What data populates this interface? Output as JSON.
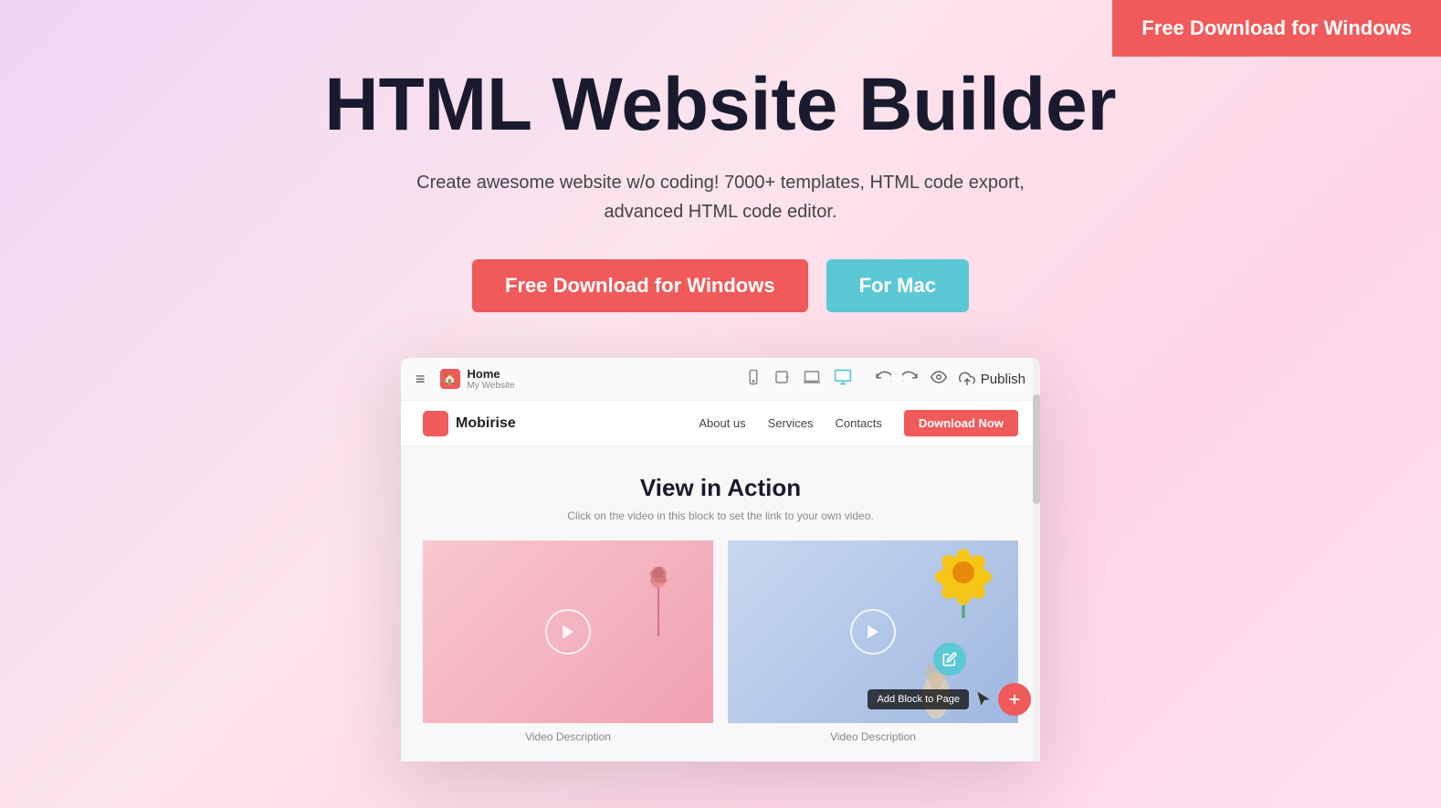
{
  "page": {
    "background": "linear-gradient(135deg, #f0d6f5, #fce4ec, #ffd6e8)"
  },
  "top_cta": {
    "label": "Free Download for Windows"
  },
  "hero": {
    "title": "HTML Website Builder",
    "subtitle": "Create awesome website w/o coding! 7000+ templates, HTML code export, advanced HTML code editor.",
    "btn_windows": "Free Download for Windows",
    "btn_mac": "For Mac"
  },
  "mockup": {
    "toolbar": {
      "menu_icon": "≡",
      "home_label": "Home",
      "home_sub": "My Website",
      "device_mobile": "📱",
      "device_tablet": "📟",
      "device_laptop": "💻",
      "device_desktop": "🖥",
      "undo_icon": "↩",
      "redo_icon": "↪",
      "preview_icon": "👁",
      "publish_icon": "☁",
      "publish_label": "Publish"
    },
    "inner_nav": {
      "logo_text": "Mobirise",
      "links": [
        "About us",
        "Services",
        "Contacts"
      ],
      "cta_label": "Download Now"
    },
    "inner_content": {
      "section_title": "View in Action",
      "section_sub": "Click on the video in this block to set the link to your own video.",
      "videos": [
        {
          "thumb_style": "pink",
          "description": "Video Description"
        },
        {
          "thumb_style": "blue",
          "description": "Video Description"
        }
      ]
    },
    "fab": {
      "edit_icon": "✎",
      "add_icon": "+",
      "tooltip": "Add Block to Page"
    }
  }
}
